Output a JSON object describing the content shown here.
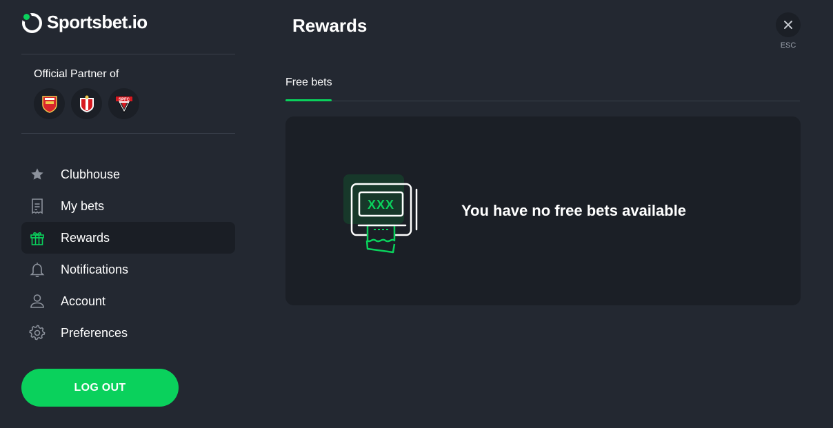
{
  "brand": {
    "name": "Sportsbet.io",
    "accent_color": "#0ad15c"
  },
  "sidebar": {
    "partner_title": "Official Partner of",
    "partners": [
      {
        "icon": "arsenal-crest-icon"
      },
      {
        "icon": "southampton-crest-icon"
      },
      {
        "icon": "spfc-crest-icon",
        "crest_text": "SPFC"
      }
    ],
    "nav": [
      {
        "label": "Clubhouse",
        "icon": "star-icon",
        "active": false
      },
      {
        "label": "My bets",
        "icon": "receipt-icon",
        "active": false
      },
      {
        "label": "Rewards",
        "icon": "gift-icon",
        "active": true
      },
      {
        "label": "Notifications",
        "icon": "bell-icon",
        "active": false
      },
      {
        "label": "Account",
        "icon": "user-icon",
        "active": false
      },
      {
        "label": "Preferences",
        "icon": "gear-icon",
        "active": false
      }
    ],
    "logout_label": "LOG OUT"
  },
  "main": {
    "title": "Rewards",
    "close_hint": "ESC",
    "tabs": [
      {
        "label": "Free bets",
        "active": true
      }
    ],
    "empty_state": {
      "message": "You have no free bets available",
      "illustration": "ticket-machine-icon",
      "illustration_text": "XXX"
    }
  }
}
